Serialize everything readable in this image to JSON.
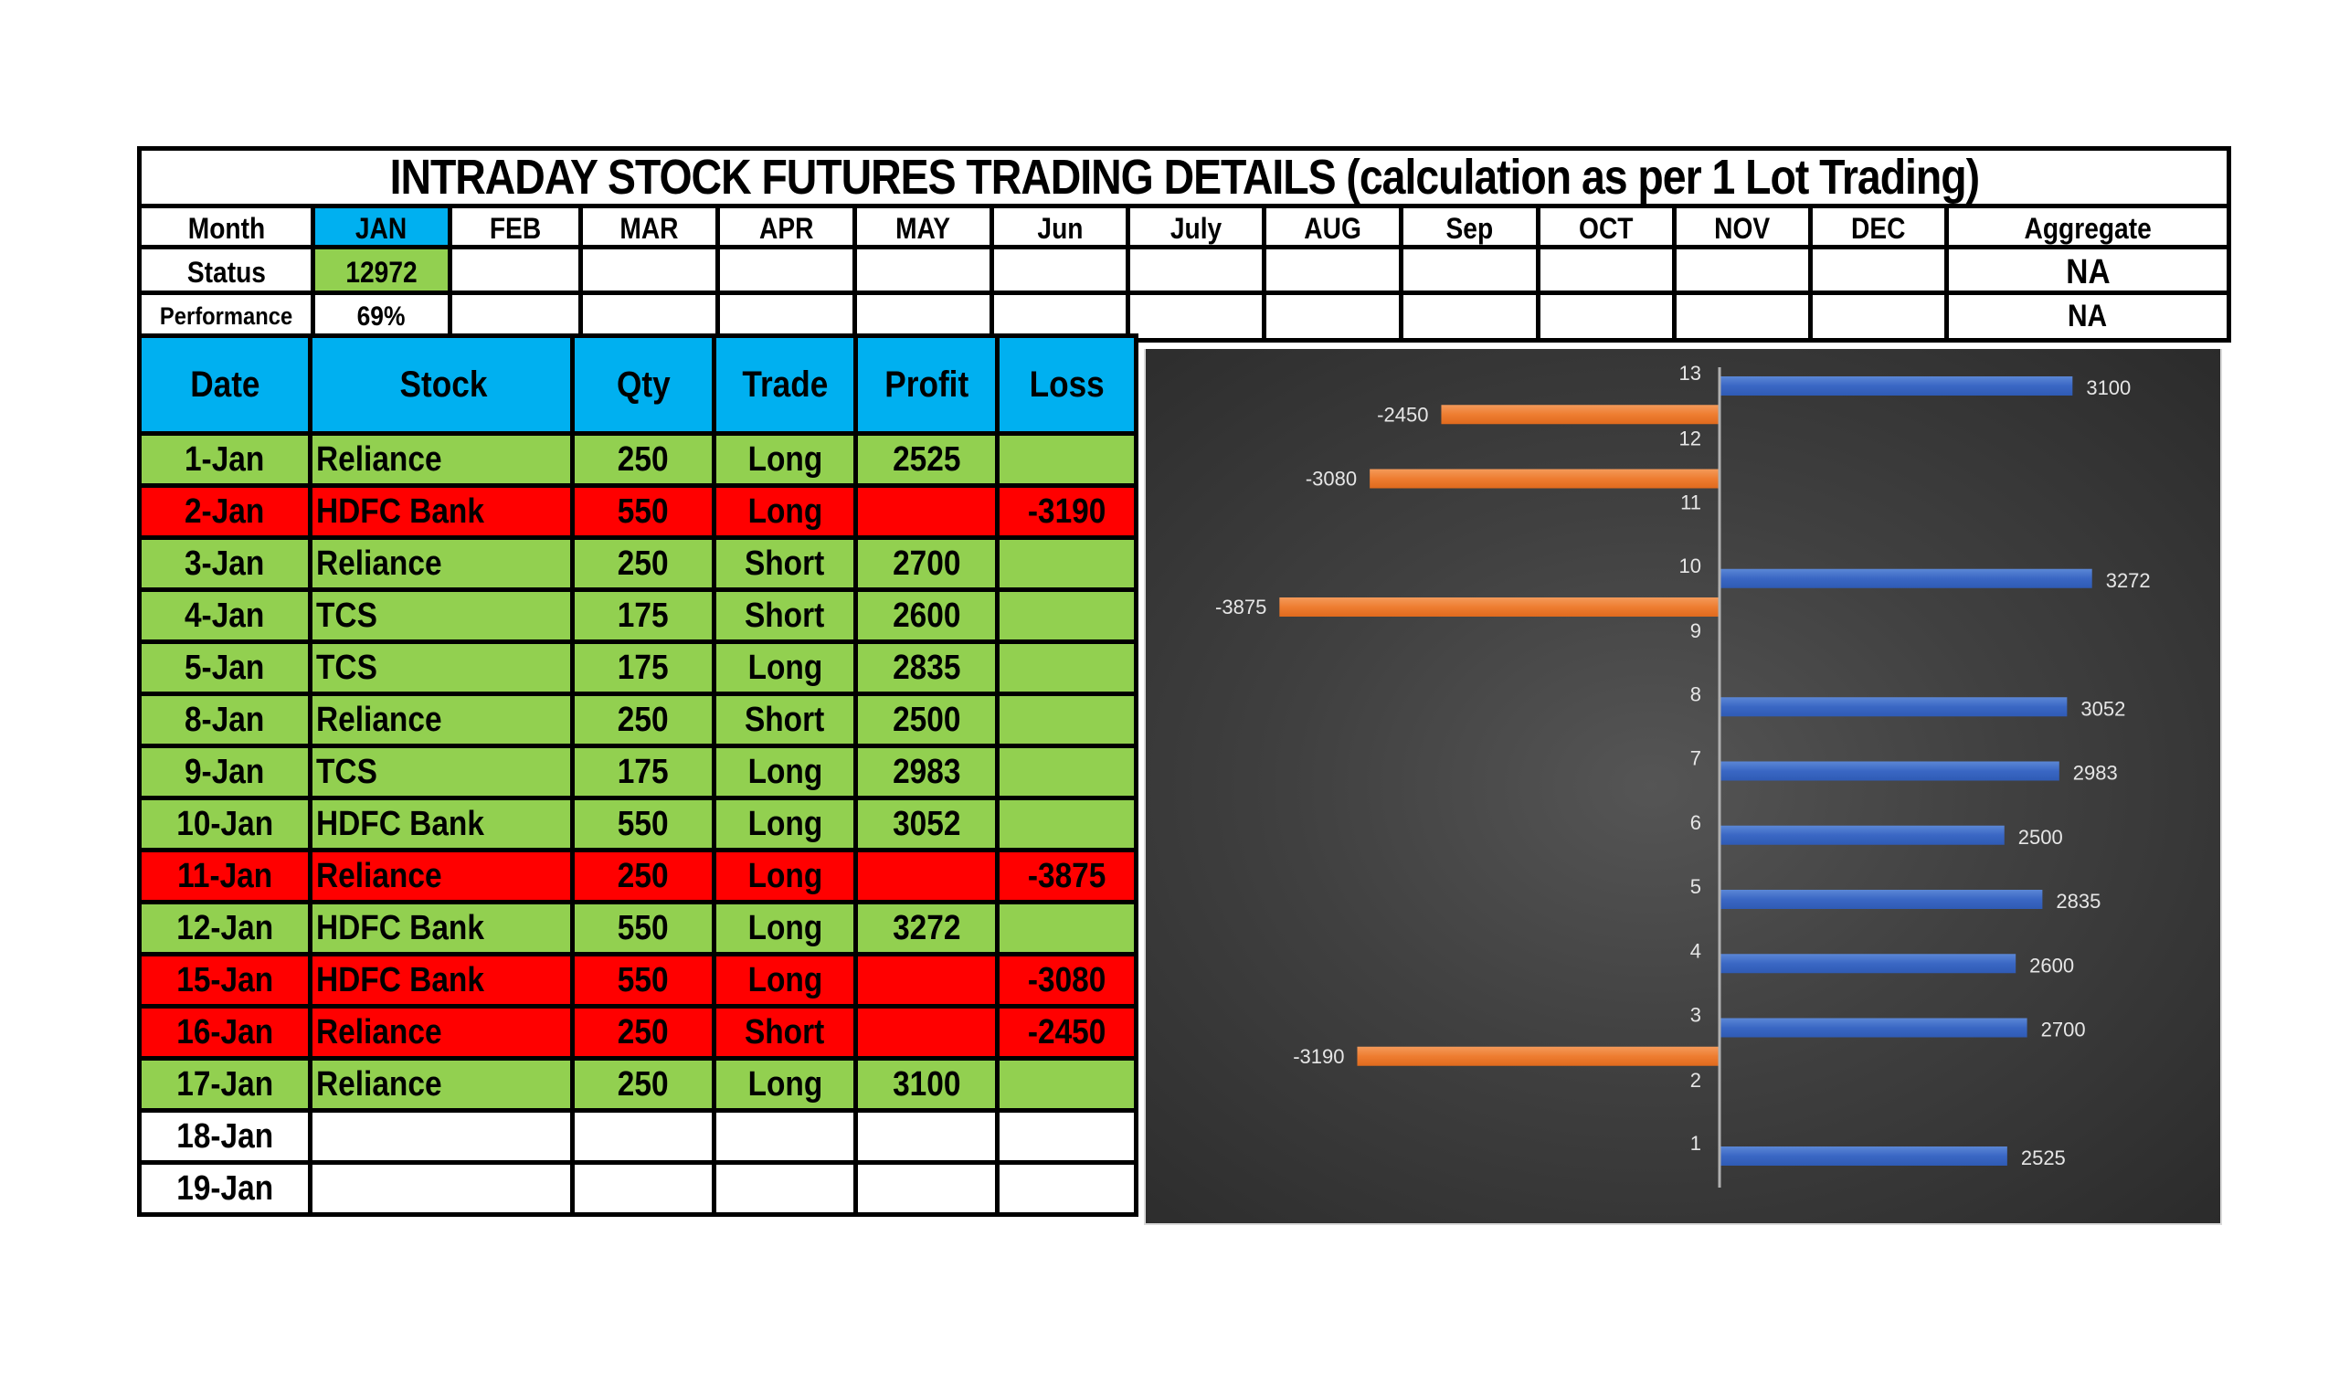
{
  "title": "INTRADAY STOCK FUTURES TRADING DETAILS (calculation as per 1 Lot Trading)",
  "summary": {
    "month_label": "Month",
    "status_label": "Status",
    "performance_label": "Performance",
    "months": [
      "JAN",
      "FEB",
      "MAR",
      "APR",
      "MAY",
      "Jun",
      "July",
      "AUG",
      "Sep",
      "OCT",
      "NOV",
      "DEC"
    ],
    "aggregate_label": "Aggregate",
    "status_values": [
      "12972",
      "",
      "",
      "",
      "",
      "",
      "",
      "",
      "",
      "",
      "",
      ""
    ],
    "performance_values": [
      "69%",
      "",
      "",
      "",
      "",
      "",
      "",
      "",
      "",
      "",
      "",
      ""
    ],
    "aggregate_status": "NA",
    "aggregate_performance": "NA",
    "active_month": "JAN"
  },
  "trades": {
    "headers": [
      "Date",
      "Stock",
      "Qty",
      "Trade",
      "Profit",
      "Loss"
    ],
    "rows": [
      {
        "date": "1-Jan",
        "stock": "Reliance",
        "qty": "250",
        "trade": "Long",
        "profit": "2525",
        "loss": "",
        "result": "win"
      },
      {
        "date": "2-Jan",
        "stock": "HDFC Bank",
        "qty": "550",
        "trade": "Long",
        "profit": "",
        "loss": "-3190",
        "result": "loss"
      },
      {
        "date": "3-Jan",
        "stock": "Reliance",
        "qty": "250",
        "trade": "Short",
        "profit": "2700",
        "loss": "",
        "result": "win"
      },
      {
        "date": "4-Jan",
        "stock": "TCS",
        "qty": "175",
        "trade": "Short",
        "profit": "2600",
        "loss": "",
        "result": "win"
      },
      {
        "date": "5-Jan",
        "stock": "TCS",
        "qty": "175",
        "trade": "Long",
        "profit": "2835",
        "loss": "",
        "result": "win"
      },
      {
        "date": "8-Jan",
        "stock": "Reliance",
        "qty": "250",
        "trade": "Short",
        "profit": "2500",
        "loss": "",
        "result": "win"
      },
      {
        "date": "9-Jan",
        "stock": "TCS",
        "qty": "175",
        "trade": "Long",
        "profit": "2983",
        "loss": "",
        "result": "win"
      },
      {
        "date": "10-Jan",
        "stock": "HDFC Bank",
        "qty": "550",
        "trade": "Long",
        "profit": "3052",
        "loss": "",
        "result": "win"
      },
      {
        "date": "11-Jan",
        "stock": "Reliance",
        "qty": "250",
        "trade": "Long",
        "profit": "",
        "loss": "-3875",
        "result": "loss"
      },
      {
        "date": "12-Jan",
        "stock": "HDFC Bank",
        "qty": "550",
        "trade": "Long",
        "profit": "3272",
        "loss": "",
        "result": "win"
      },
      {
        "date": "15-Jan",
        "stock": "HDFC Bank",
        "qty": "550",
        "trade": "Long",
        "profit": "",
        "loss": "-3080",
        "result": "loss"
      },
      {
        "date": "16-Jan",
        "stock": "Reliance",
        "qty": "250",
        "trade": "Short",
        "profit": "",
        "loss": "-2450",
        "result": "loss"
      },
      {
        "date": "17-Jan",
        "stock": "Reliance",
        "qty": "250",
        "trade": "Long",
        "profit": "3100",
        "loss": "",
        "result": "win"
      },
      {
        "date": "18-Jan",
        "stock": "",
        "qty": "",
        "trade": "",
        "profit": "",
        "loss": "",
        "result": "empty"
      },
      {
        "date": "19-Jan",
        "stock": "",
        "qty": "",
        "trade": "",
        "profit": "",
        "loss": "",
        "result": "empty"
      }
    ]
  },
  "colors": {
    "header_blue": "#00b0f0",
    "win_green": "#92d050",
    "loss_red": "#ff0000",
    "profit_bar": "#4472c4",
    "loss_bar": "#ed7d31",
    "chart_bg": "#404040"
  },
  "chart_data": {
    "type": "bar",
    "orientation": "horizontal",
    "title": "",
    "xlabel": "",
    "ylabel": "",
    "categories": [
      "1",
      "2",
      "3",
      "4",
      "5",
      "6",
      "7",
      "8",
      "9",
      "10",
      "11",
      "12",
      "13"
    ],
    "series": [
      {
        "name": "Profit",
        "color": "#4472c4",
        "values": [
          2525,
          null,
          2700,
          2600,
          2835,
          2500,
          2983,
          3052,
          null,
          3272,
          null,
          null,
          3100
        ]
      },
      {
        "name": "Loss",
        "color": "#ed7d31",
        "values": [
          null,
          -3190,
          null,
          null,
          null,
          null,
          null,
          null,
          -3875,
          null,
          -3080,
          -2450,
          null
        ]
      }
    ],
    "xlim": [
      -4000,
      4000
    ],
    "grid": false,
    "legend": "none",
    "data_labels": true
  }
}
